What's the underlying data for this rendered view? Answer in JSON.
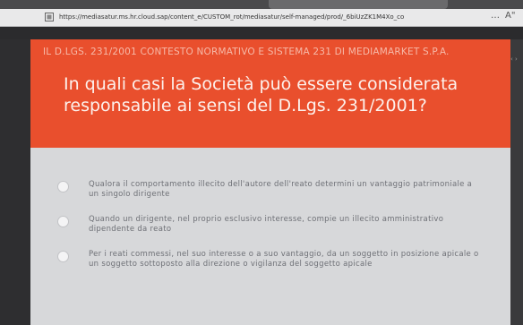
{
  "browser": {
    "url": "https://mediasatur.ms.hr.cloud.sap/content_e/CUSTOM_rot/mediasatur/self-managed/prod/_6biUzZK1M4Xo_co",
    "more_label": "…",
    "ext_label": "A\""
  },
  "course": {
    "breadcrumb": "Il D.Lgs. 231/2001 contesto normativo e sistema 231 di MediaMarket S.p.A.",
    "question": "In quali casi la Società può essere considerata responsabile ai sensi del D.Lgs. 231/2001?",
    "options": [
      {
        "text": "Qualora il comportamento illecito dell'autore dell'reato determini un vantaggio patrimoniale a un singolo dirigente"
      },
      {
        "text": "Quando un dirigente, nel proprio esclusivo interesse, compie un illecito amministrativo dipendente da reato"
      },
      {
        "text": "Per i reati commessi, nel suo interesse o a suo vantaggio, da un soggetto in posizione apicale o un soggetto sottoposto alla direzione o vigilanza del soggetto apicale"
      }
    ]
  },
  "side": {
    "hint": "‹ ›"
  },
  "colors": {
    "header_bg": "#e94f2d",
    "page_bg": "#d7d8da",
    "option_text": "#6e7076"
  }
}
